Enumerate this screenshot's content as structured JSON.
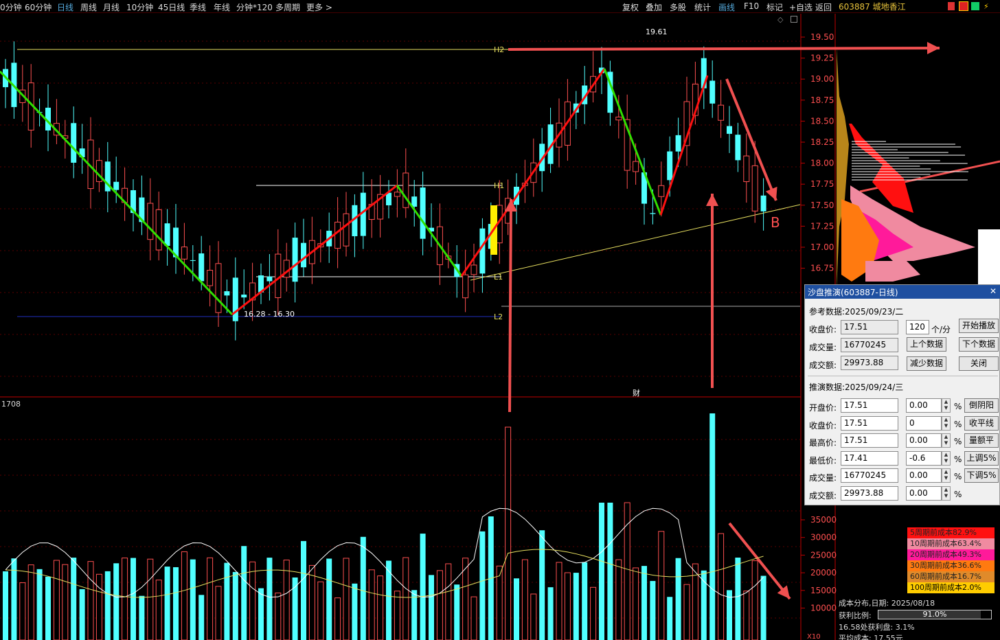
{
  "toolbar": {
    "timeframes": [
      "0分钟",
      "60分钟",
      "日线",
      "周线",
      "月线",
      "10分钟",
      "45日线",
      "季线",
      "年线",
      "分钟*120",
      "多周期",
      "更多 >"
    ],
    "active_timeframe": "日线",
    "buttons": [
      "复权",
      "叠加",
      "多股",
      "统计",
      "画线",
      "F10",
      "标记",
      "+自选",
      "返回"
    ],
    "active_button": "画线"
  },
  "stock": {
    "code": "603887",
    "name": "城地香江"
  },
  "price_axis": {
    "labels": [
      "19.50",
      "19.25",
      "19.00",
      "18.75",
      "18.50",
      "18.25",
      "18.00",
      "17.75",
      "17.50",
      "17.25",
      "17.00",
      "16.75"
    ]
  },
  "annotations": {
    "high_price": "19.61",
    "range": "16.28 - 16.30",
    "lines": [
      "H2",
      "H1",
      "L1",
      "L2"
    ],
    "marker_b": "B",
    "event_marker": "财"
  },
  "volume": {
    "header": "1708",
    "axis_labels": [
      "35000",
      "30000",
      "25000",
      "20000",
      "15000",
      "10000"
    ],
    "axis_unit": "X10"
  },
  "dialog": {
    "title": "沙盘推演(603887-日线)",
    "ref_header": "参考数据:2025/09/23/二",
    "ref": {
      "close_label": "收盘价:",
      "close": "17.51",
      "volume_label": "成交量:",
      "volume": "16770245",
      "amount_label": "成交额:",
      "amount": "29973.88"
    },
    "speed_value": "120",
    "speed_unit": "个/分",
    "buttons": {
      "play": "开始播放",
      "prev": "上个数据",
      "next": "下个数据",
      "reduce": "减少数据",
      "close": "关闭"
    },
    "sim_header": "推演数据:2025/09/24/三",
    "sim": [
      {
        "label": "开盘价:",
        "value": "17.51",
        "pct": "0.00",
        "btn": "倒阴阳"
      },
      {
        "label": "收盘价:",
        "value": "17.51",
        "pct": "0",
        "btn": "收平线"
      },
      {
        "label": "最高价:",
        "value": "17.51",
        "pct": "0.00",
        "btn": "量额平"
      },
      {
        "label": "最低价:",
        "value": "17.41",
        "pct": "-0.6",
        "btn": "上调5%"
      },
      {
        "label": "成交量:",
        "value": "16770245",
        "pct": "0.00",
        "btn": "下调5%"
      },
      {
        "label": "成交额:",
        "value": "29973.88",
        "pct": "0.00",
        "btn": ""
      }
    ],
    "pct_symbol": "%"
  },
  "cost_legend": [
    {
      "text": "5周期前成本82.9%",
      "color": "#ff1010"
    },
    {
      "text": "10周期前成本63.4%",
      "color": "#f08aa0"
    },
    {
      "text": "20周期前成本49.3%",
      "color": "#ff1a9a"
    },
    {
      "text": "30周期前成本36.6%",
      "color": "#ff7a10"
    },
    {
      "text": "60周期前成本16.7%",
      "color": "#e08a2a"
    },
    {
      "text": "100周期前成本2.0%",
      "color": "#ffcc00"
    }
  ],
  "cost_info": {
    "date_line": "成本分布,日期: 2025/08/18",
    "profit_label": "获利比例:",
    "profit_ratio_value": 0.91,
    "profit_ratio": "91.0%",
    "profit_line": "16.58处获利盘: 3.1%",
    "avg_line": "平均成本: 17.55元"
  },
  "colors": {
    "up": "#ff5050",
    "down": "#50ffff",
    "bg": "#000000",
    "axis": "#c00000",
    "zig_up": "#ff1010",
    "zig_down": "#30e000"
  }
}
